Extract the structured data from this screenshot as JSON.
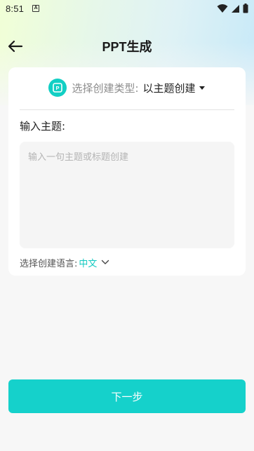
{
  "status_bar": {
    "time": "8:51",
    "notification_icon_text": "A",
    "icons": [
      "wifi-icon",
      "signal-icon",
      "battery-icon"
    ]
  },
  "header": {
    "title": "PPT生成",
    "back_icon": "arrow-left-icon"
  },
  "card": {
    "type_selector": {
      "icon": "ppt-icon",
      "label": "选择创建类型:",
      "value": "以主题创建"
    },
    "topic": {
      "label": "输入主题:",
      "placeholder": "输入一句主题或标题创建",
      "value": ""
    },
    "language": {
      "label": "选择创建语言:",
      "value": "中文"
    }
  },
  "next_button": {
    "label": "下一步"
  },
  "colors": {
    "accent": "#15d1cb",
    "page_background": "#f7f7f7",
    "card_background": "#ffffff"
  }
}
